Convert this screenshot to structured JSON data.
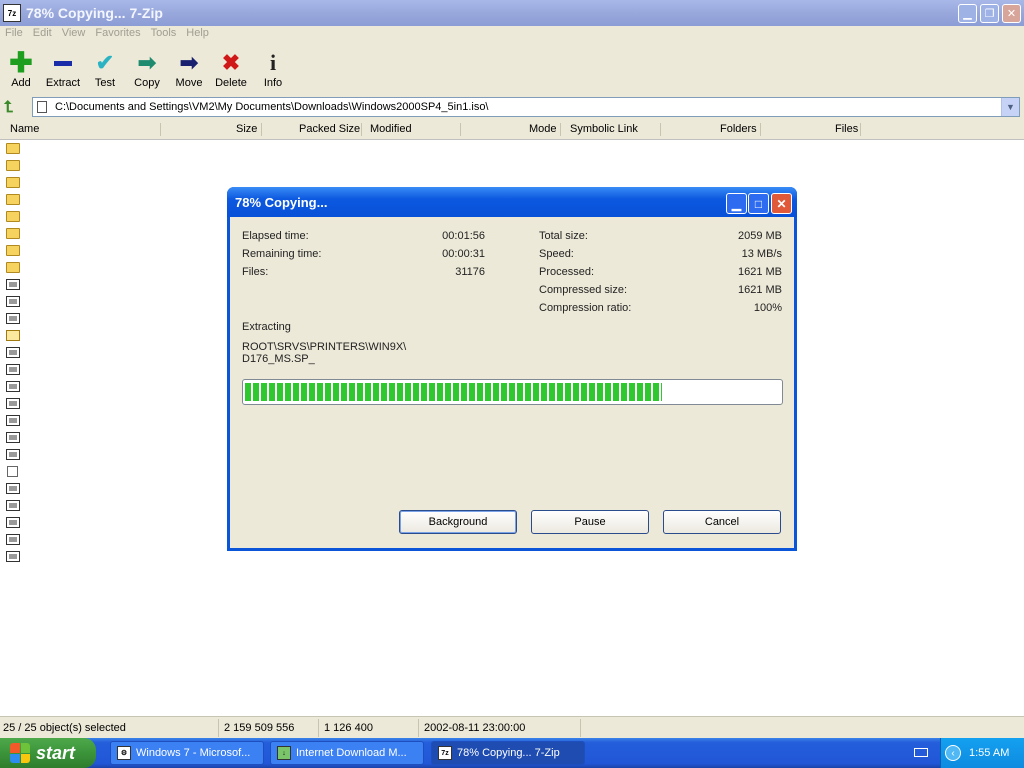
{
  "window": {
    "title": "78% Copying... 7-Zip",
    "app_icon": "7z"
  },
  "menu": [
    "File",
    "Edit",
    "View",
    "Favorites",
    "Tools",
    "Help"
  ],
  "toolbar": [
    {
      "name": "add",
      "label": "Add",
      "icon": "plus-icon",
      "color": "#1e9e1e"
    },
    {
      "name": "extract",
      "label": "Extract",
      "icon": "minus-icon",
      "color": "#1a2ca8"
    },
    {
      "name": "test",
      "label": "Test",
      "icon": "check-icon",
      "color": "#2bb3c4"
    },
    {
      "name": "copy",
      "label": "Copy",
      "icon": "arrow-right-icon",
      "color": "#1e8a6e"
    },
    {
      "name": "move",
      "label": "Move",
      "icon": "arrow-right-icon",
      "color": "#1a2070"
    },
    {
      "name": "delete",
      "label": "Delete",
      "icon": "x-icon",
      "color": "#d01818"
    },
    {
      "name": "info",
      "label": "Info",
      "icon": "info-icon",
      "color": "#222222"
    }
  ],
  "address": {
    "path": "C:\\Documents and Settings\\VM2\\My Documents\\Downloads\\Windows2000SP4_5in1.iso\\"
  },
  "columns": [
    "Name",
    "Size",
    "Packed Size",
    "Modified",
    "Mode",
    "Symbolic Link",
    "Folders",
    "Files"
  ],
  "file_icons": [
    "folder",
    "folder",
    "folder",
    "folder",
    "folder",
    "folder",
    "folder",
    "folder",
    "file",
    "file",
    "file",
    "cfg",
    "file",
    "file",
    "file",
    "file",
    "file",
    "file",
    "file",
    "txt",
    "file",
    "file",
    "file",
    "file",
    "file"
  ],
  "dialog": {
    "title": "78% Copying...",
    "left": [
      {
        "label": "Elapsed time:",
        "value": "00:01:56"
      },
      {
        "label": "Remaining time:",
        "value": "00:00:31"
      },
      {
        "label": "Files:",
        "value": "31176"
      }
    ],
    "right": [
      {
        "label": "Total size:",
        "value": "2059 MB"
      },
      {
        "label": "Speed:",
        "value": "13 MB/s"
      },
      {
        "label": "Processed:",
        "value": "1621 MB"
      },
      {
        "label": "Compressed size:",
        "value": "1621 MB"
      },
      {
        "label": "Compression ratio:",
        "value": "100%"
      }
    ],
    "action": "Extracting",
    "current_path_line1": "ROOT\\SRVS\\PRINTERS\\WIN9X\\",
    "current_path_line2": "D176_MS.SP_",
    "progress_percent": 78,
    "buttons": {
      "background": "Background",
      "pause": "Pause",
      "cancel": "Cancel"
    }
  },
  "status": {
    "selected": "25 / 25 object(s) selected",
    "size": "2 159 509 556",
    "packed": "1 126 400",
    "date": "2002-08-11 23:00:00"
  },
  "taskbar": {
    "start_label": "start",
    "tasks": [
      {
        "label": "Windows 7 - Microsof...",
        "icon": "gear-icon",
        "active": false
      },
      {
        "label": "Internet Download M...",
        "icon": "download-icon",
        "active": false
      },
      {
        "label": "78% Copying... 7-Zip",
        "icon": "7z",
        "active": true
      }
    ],
    "clock": "1:55 AM"
  },
  "colors": {
    "title_bar": "#0a55d8",
    "progress": "#2fc82f",
    "taskbar": "#245edb",
    "start": "#3c943a"
  }
}
